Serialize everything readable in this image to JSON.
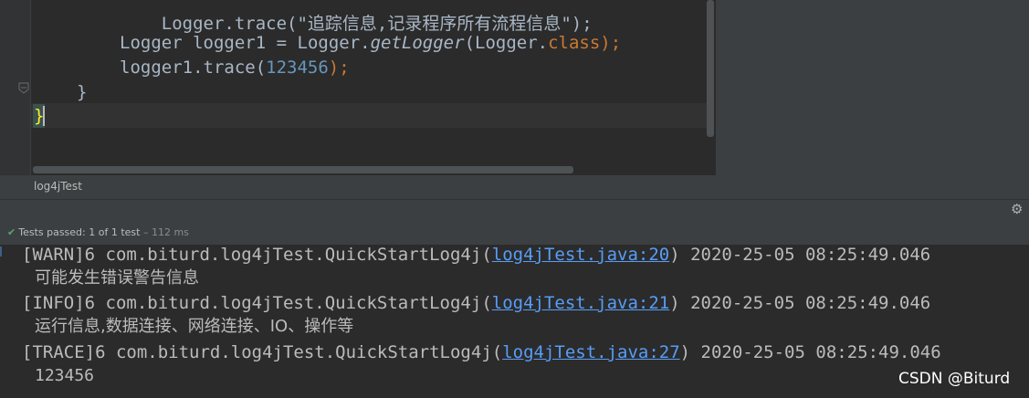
{
  "editor": {
    "line_top_partial": "Logger.trace(\"追踪信息,记录程序所有流程信息\");",
    "line_decl_type": "Logger",
    "line_decl_var": "logger1",
    "line_decl_eq": "=",
    "line_decl_class": "Logger.",
    "line_decl_method": "getLogger",
    "line_decl_arg": "(Logger.",
    "line_decl_kw": "class",
    "line_decl_end": ");",
    "line_trace_call": "logger1.trace(",
    "line_trace_num": "123456",
    "line_trace_end": ");",
    "brace_method": "}",
    "brace_class": "}"
  },
  "breadcrumb": "log4jTest",
  "test_status": {
    "label": "Tests passed:",
    "count": "1 of 1 test",
    "duration": "– 112 ms"
  },
  "console": [
    {
      "prefix": "[WARN]6 com.biturd.log4jTest.QuickStartLog4j(",
      "link": "log4jTest.java:20",
      "suffix": ") 2020-25-05 08:25:49.046",
      "message": "可能发生错误警告信息"
    },
    {
      "prefix": "[INFO]6 com.biturd.log4jTest.QuickStartLog4j(",
      "link": "log4jTest.java:21",
      "suffix": ") 2020-25-05 08:25:49.046",
      "message": "运行信息,数据连接、网络连接、IO、操作等"
    },
    {
      "prefix": "[TRACE]6 com.biturd.log4jTest.QuickStartLog4j(",
      "link": "log4jTest.java:27",
      "suffix": ") 2020-25-05 08:25:49.046",
      "message": "123456"
    }
  ],
  "watermark": "CSDN @Biturd",
  "icons": {
    "gear": "gear-icon",
    "check": "check-icon",
    "fold": "fold-marker-icon"
  },
  "colors": {
    "editor_bg": "#2b2b2b",
    "panel_bg": "#3c3f41",
    "keyword": "#cc7832",
    "number": "#6897bb",
    "link": "#589df6",
    "pass_green": "#59a869"
  }
}
